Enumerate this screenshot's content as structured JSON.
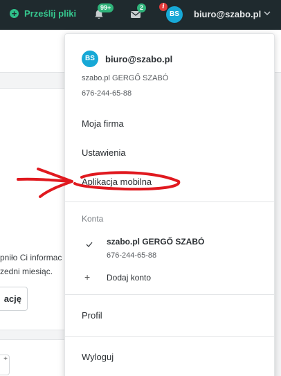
{
  "topbar": {
    "upload_label": "Prześlij pliki",
    "notifications_badge": "99+",
    "messages_badge": "2",
    "info_glyph": "i",
    "avatar_initials": "BS",
    "user_email": "biuro@szabo.pl",
    "icons": [
      "plus-circle-icon",
      "bell-icon",
      "envelope-icon",
      "info-icon",
      "chevron-down-icon"
    ]
  },
  "background": {
    "text_line1": "pniło Ci informac",
    "text_line2": "zedni miesiąc.",
    "button_label": "ację",
    "plus_glyph": "+"
  },
  "menu": {
    "avatar_initials": "BS",
    "email": "biuro@szabo.pl",
    "company": "szabo.pl GERGŐ SZABÓ",
    "phone": "676-244-65-88",
    "items": {
      "firma": "Moja firma",
      "ustawienia": "Ustawienia",
      "mobile": "Aplikacja mobilna",
      "profil": "Profil",
      "wyloguj": "Wyloguj"
    },
    "accounts_header": "Konta",
    "account": {
      "name": "szabo.pl GERGŐ SZABÓ",
      "phone": "676-244-65-88"
    },
    "add_account": "Dodaj konto"
  },
  "colors": {
    "topbar_bg": "#1f2a2e",
    "accent_green": "#36c78e",
    "avatar_blue": "#17a8d6",
    "alert_red": "#e33b3b",
    "annotation_red": "#e0191f"
  }
}
